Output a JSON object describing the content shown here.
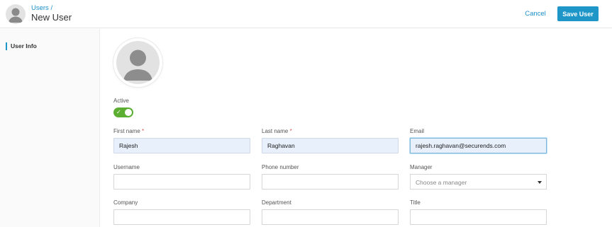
{
  "header": {
    "breadcrumb": "Users /",
    "title": "New User",
    "cancel_label": "Cancel",
    "save_label": "Save User"
  },
  "sidebar": {
    "items": [
      {
        "label": "User Info",
        "active": true
      }
    ]
  },
  "form": {
    "active": {
      "label": "Active",
      "value": true
    },
    "first_name": {
      "label": "First name",
      "required_mark": "*",
      "value": "Rajesh"
    },
    "last_name": {
      "label": "Last name",
      "required_mark": "*",
      "value": "Raghavan"
    },
    "email": {
      "label": "Email",
      "value": "rajesh.raghavan@securends.com"
    },
    "username": {
      "label": "Username",
      "value": ""
    },
    "phone": {
      "label": "Phone number",
      "value": ""
    },
    "manager": {
      "label": "Manager",
      "placeholder": "Choose a manager"
    },
    "company": {
      "label": "Company",
      "value": ""
    },
    "department": {
      "label": "Department",
      "value": ""
    },
    "title": {
      "label": "Title",
      "value": ""
    }
  },
  "colors": {
    "accent": "#1e96c8",
    "toggle_on": "#5cae33",
    "required": "#d9534f",
    "filled_field": "#e8f0fb"
  }
}
